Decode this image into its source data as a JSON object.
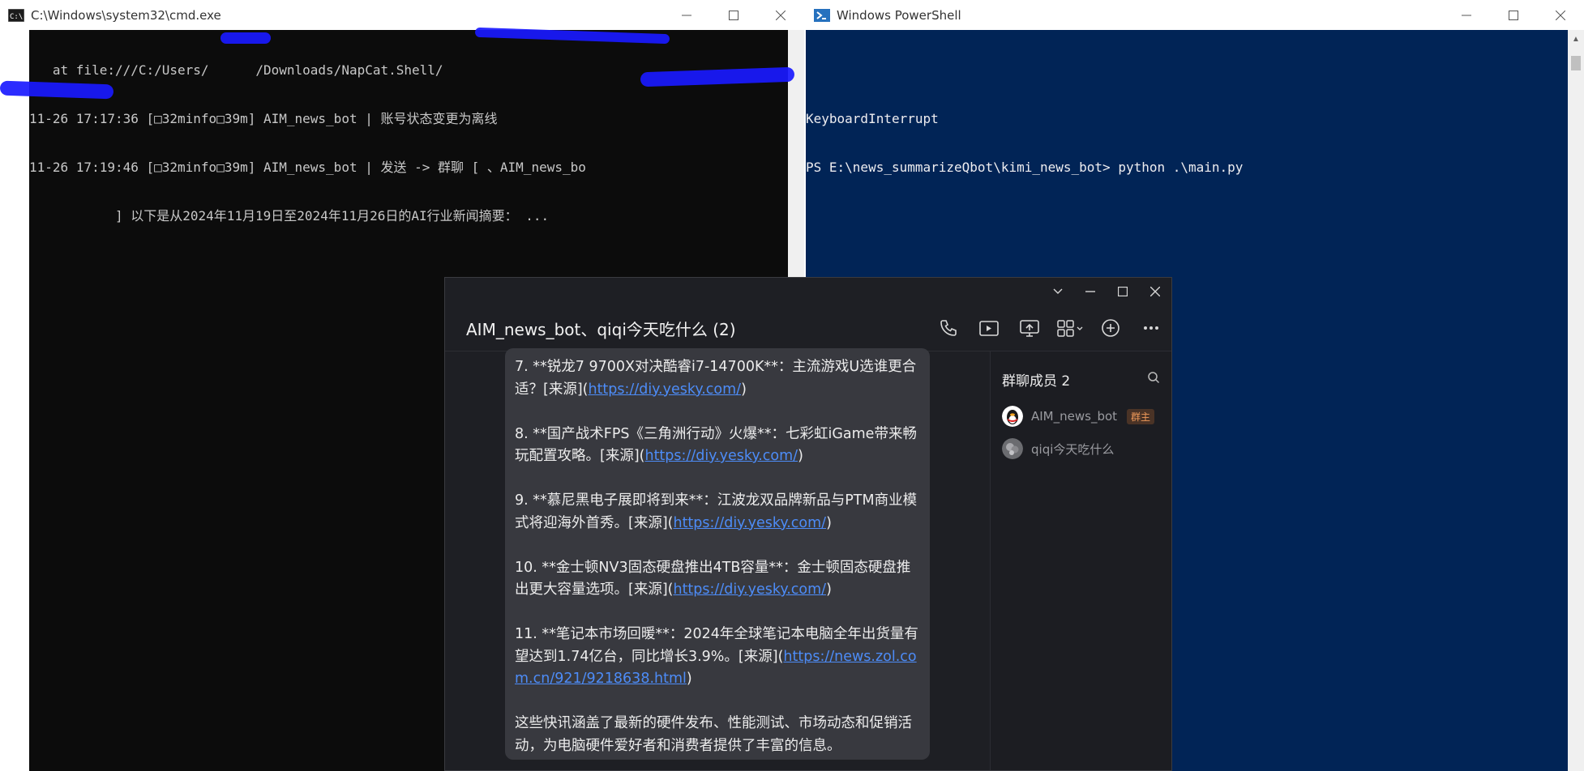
{
  "cmd": {
    "title": "C:\\Windows\\system32\\cmd.exe",
    "lines": [
      "   at file:///C:/Users/      /Downloads/NapCat.Shell/",
      "11-26 17:17:36 [□32minfo□39m] AIM_news_bot | 账号状态变更为离线",
      "11-26 17:19:46 [□32minfo□39m] AIM_news_bot | 发送 -> 群聊 [ 、AIM_news_bo",
      "           ] 以下是从2024年11月19日至2024年11月26日的AI行业新闻摘要： ..."
    ]
  },
  "powershell": {
    "title": "Windows PowerShell",
    "lines": [
      "  ^^^^^^^^^^^^^^",
      "KeyboardInterrupt",
      "PS E:\\news_summarizeQbot\\kimi_news_bot> python .\\main.py"
    ]
  },
  "qq": {
    "title": "AIM_news_bot、qiqi今天吃什么 (2)",
    "toolbar_icons": [
      "phone-icon",
      "video-icon",
      "screen-share-icon",
      "apps-icon",
      "add-icon",
      "more-icon"
    ],
    "messages": [
      {
        "text": "7. **锐龙7 9700X对决酷睿i7-14700K**：主流游戏U选谁更合适？[来源](",
        "link": "https://diy.yesky.com/",
        "tail": ")"
      },
      {
        "text": "8. **国产战术FPS《三角洲行动》火爆**：七彩虹iGame带来畅玩配置攻略。[来源](",
        "link": "https://diy.yesky.com/",
        "tail": ")"
      },
      {
        "text": "9. **慕尼黑电子展即将到来**：江波龙双品牌新品与PTM商业模式将迎海外首秀。[来源](",
        "link": "https://diy.yesky.com/",
        "tail": ")"
      },
      {
        "text": "10. **金士顿NV3固态硬盘推出4TB容量**：金士顿固态硬盘推出更大容量选项。[来源](",
        "link": "https://diy.yesky.com/",
        "tail": ")"
      },
      {
        "text": "11. **笔记本市场回暖**：2024年全球笔记本电脑全年出货量有望达到1.74亿台，同比增长3.9%。[来源](",
        "link": "https://news.zol.com.cn/921/9218638.html",
        "tail": ")"
      },
      {
        "text": "这些快讯涵盖了最新的硬件发布、性能测试、市场动态和促销活动，为电脑硬件爱好者和消费者提供了丰富的信息。",
        "link": "",
        "tail": ""
      }
    ],
    "members_title": "群聊成员 2",
    "members": [
      {
        "name": "AIM_news_bot",
        "badge": "群主"
      },
      {
        "name": "qiqi今天吃什么",
        "badge": ""
      }
    ]
  },
  "colors": {
    "cmd_bg": "#0c0c0c",
    "powershell_bg": "#012456",
    "qq_bg": "#1e1f24",
    "bubble_bg": "#38393f",
    "link": "#4d8cf7",
    "owner_badge": "#f09a5a"
  }
}
